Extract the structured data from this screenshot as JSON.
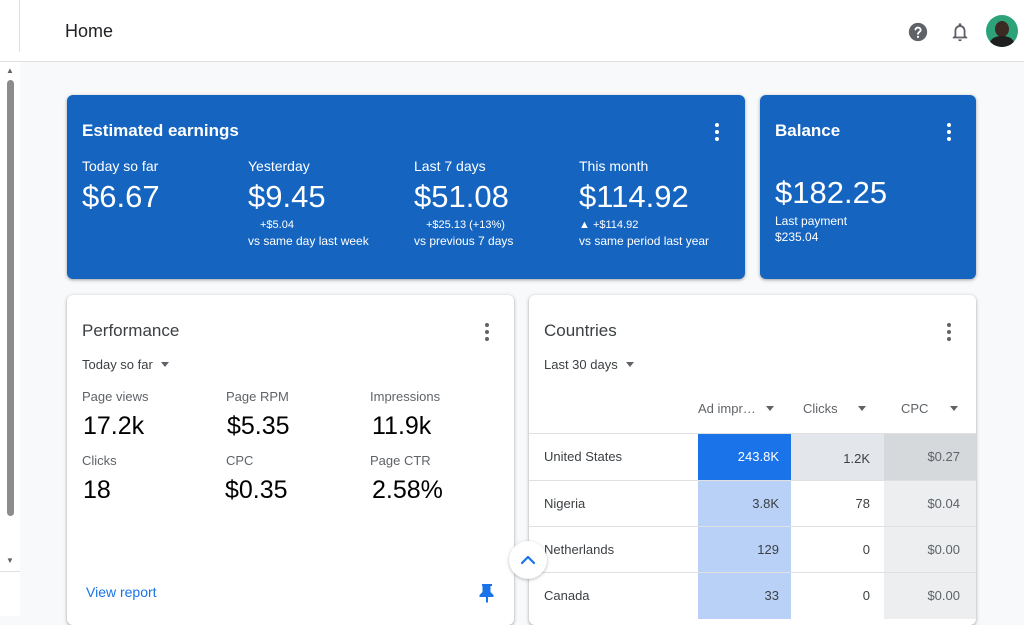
{
  "header": {
    "title": "Home"
  },
  "earnings": {
    "title": "Estimated earnings",
    "metrics": [
      {
        "label": "Today so far",
        "value": "$6.67",
        "delta": "",
        "comparison": ""
      },
      {
        "label": "Yesterday",
        "value": "$9.45",
        "delta": "+$5.04",
        "comparison": "vs same day last week"
      },
      {
        "label": "Last 7 days",
        "value": "$51.08",
        "delta": "+$25.13 (+13%)",
        "comparison": "vs previous 7 days"
      },
      {
        "label": "This month",
        "value": "$114.92",
        "delta": "▲ +$114.92",
        "comparison": "vs same period last year"
      }
    ]
  },
  "balance": {
    "title": "Balance",
    "value": "$182.25",
    "last_payment_label": "Last payment",
    "last_payment_value": "$235.04"
  },
  "performance": {
    "title": "Performance",
    "range": "Today so far",
    "metrics": [
      {
        "label": "Page views",
        "value": "17.2k"
      },
      {
        "label": "Page RPM",
        "value": "$5.35"
      },
      {
        "label": "Impressions",
        "value": "11.9k"
      },
      {
        "label": "Clicks",
        "value": "18"
      },
      {
        "label": "CPC",
        "value": "$0.35"
      },
      {
        "label": "Page CTR",
        "value": "2.58%"
      }
    ],
    "view_report": "View report"
  },
  "countries": {
    "title": "Countries",
    "range": "Last 30 days",
    "columns": [
      "Ad impr…",
      "Clicks",
      "CPC"
    ],
    "rows": [
      {
        "country": "United States",
        "impressions": "243.8K",
        "clicks": "1.2K",
        "cpc": "$0.27"
      },
      {
        "country": "Nigeria",
        "impressions": "3.8K",
        "clicks": "78",
        "cpc": "$0.04"
      },
      {
        "country": "Netherlands",
        "impressions": "129",
        "clicks": "0",
        "cpc": "$0.00"
      },
      {
        "country": "Canada",
        "impressions": "33",
        "clicks": "0",
        "cpc": "$0.00"
      }
    ]
  },
  "icons": [
    "help-icon",
    "bell-icon",
    "more-vert-icon",
    "pin-icon",
    "chevron-up-icon",
    "dropdown-caret-icon"
  ],
  "colors": {
    "primary": "#1565c0",
    "accent": "#1a73e8",
    "heat_light": "#b9d1f7"
  }
}
